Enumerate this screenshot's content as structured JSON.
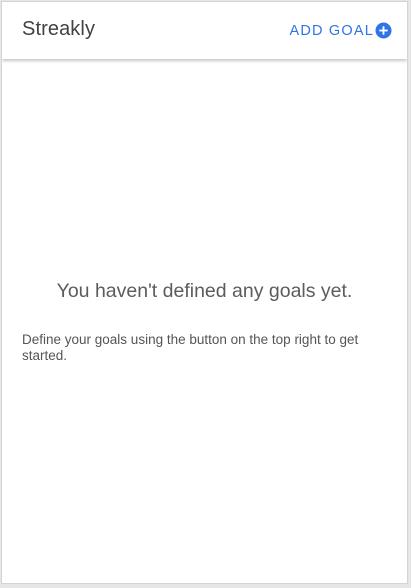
{
  "app": {
    "title": "Streakly"
  },
  "toolbar": {
    "add_goal_label": "ADD GOAL",
    "add_goal_icon": "plus-circle-icon"
  },
  "empty_state": {
    "title": "You haven't defined any goals yet.",
    "description": "Define your goals using the button on the top right to get started."
  },
  "colors": {
    "accent": "#2f74e6",
    "title_text": "#424242",
    "body_text": "#555555",
    "background": "#ffffff"
  }
}
